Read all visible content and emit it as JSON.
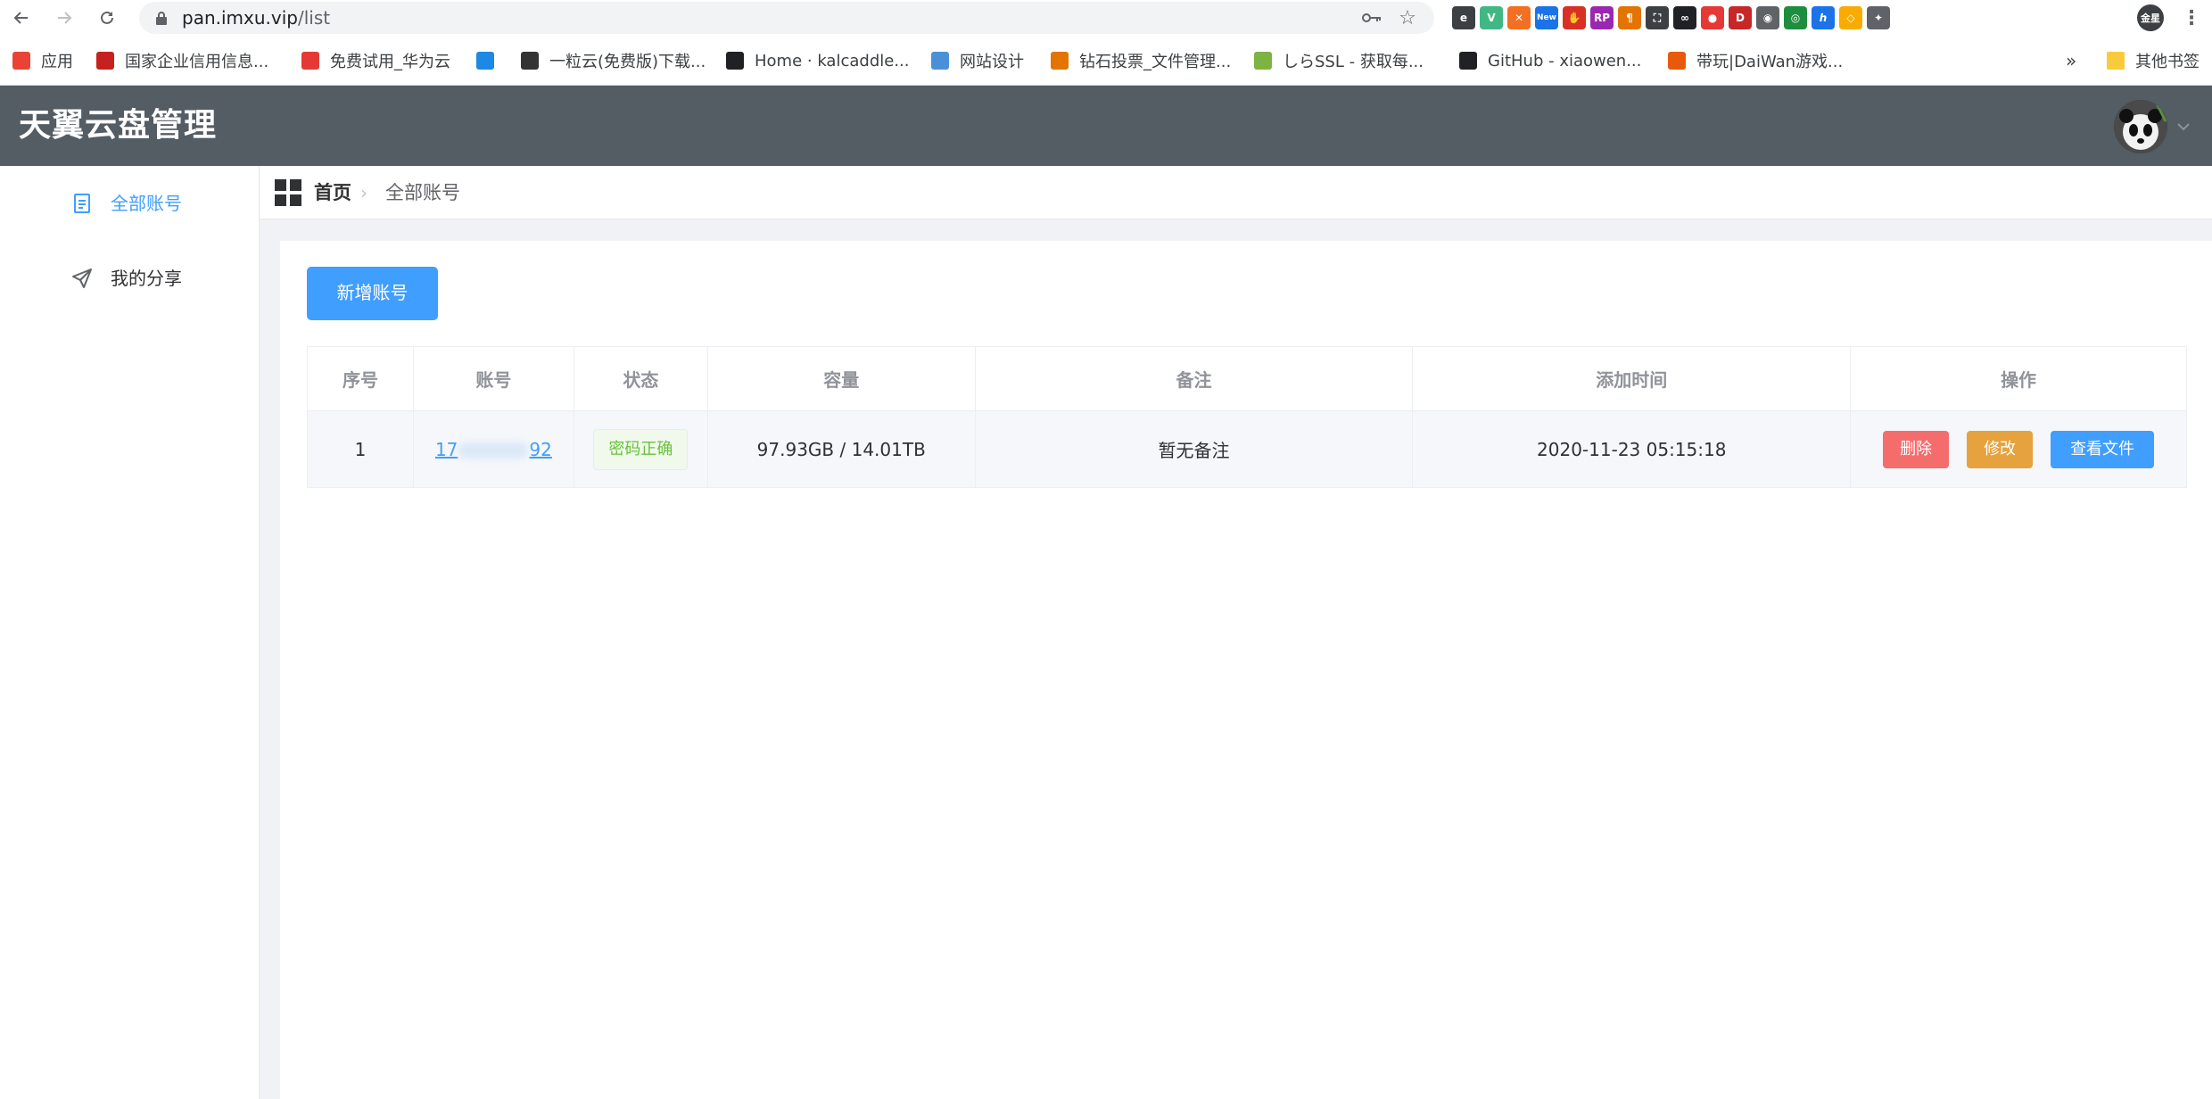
{
  "browser": {
    "url_host": "pan.imxu.vip",
    "url_path": "/list",
    "extensions": [
      {
        "icon": "edge-e-icon",
        "color": "#3c4043",
        "text": "e"
      },
      {
        "icon": "vue-icon",
        "color": "#41b883",
        "text": "V"
      },
      {
        "icon": "orange-circle-icon",
        "color": "#f36f21",
        "text": "✕"
      },
      {
        "icon": "new-badge-icon",
        "color": "#1a73e8",
        "text": "New"
      },
      {
        "icon": "red-hand-icon",
        "color": "#d93025",
        "text": "✋"
      },
      {
        "icon": "axure-rp-icon",
        "color": "#9b27b0",
        "text": "RP"
      },
      {
        "icon": "paragraph-icon",
        "color": "#e37400",
        "text": "¶"
      },
      {
        "icon": "screenshot-frame-icon",
        "color": "#3c4043",
        "text": "⛶"
      },
      {
        "icon": "glasses-icon",
        "color": "#202124",
        "text": "∞"
      },
      {
        "icon": "red-dot-icon",
        "color": "#e53935",
        "text": "●"
      },
      {
        "icon": "dt-icon",
        "color": "#c62828",
        "text": "D"
      },
      {
        "icon": "camera-icon",
        "color": "#5f6368",
        "text": "◉"
      },
      {
        "icon": "green-chat-icon",
        "color": "#1e8e3e",
        "text": "◎"
      },
      {
        "icon": "hh-icon",
        "color": "#1a73e8",
        "text": "ℎ"
      },
      {
        "icon": "orange-box-icon",
        "color": "#f9ab00",
        "text": "◇"
      },
      {
        "icon": "puzzle-icon",
        "color": "#5f6368",
        "text": "✦"
      }
    ],
    "profile_label": "金星"
  },
  "bookmarks": [
    {
      "label": "应用",
      "icon": "apps-grid-icon",
      "color": "#ea4335"
    },
    {
      "label": "国家企业信用信息...",
      "icon": "emblem-icon",
      "color": "#c5221f"
    },
    {
      "label": "免费试用_华为云",
      "icon": "huawei-icon",
      "color": "#e53935"
    },
    {
      "label": "",
      "icon": "m-icon",
      "color": "#1e88e5"
    },
    {
      "label": "一粒云(免费版)下载...",
      "icon": "yiliyun-icon",
      "color": "#333333"
    },
    {
      "label": "Home · kalcaddle...",
      "icon": "github-icon",
      "color": "#202124"
    },
    {
      "label": "网站设计",
      "icon": "cloud-icon",
      "color": "#4a90d9"
    },
    {
      "label": "钻石投票_文件管理...",
      "icon": "chart-icon",
      "color": "#e37400"
    },
    {
      "label": "しらSSL - 获取每...",
      "icon": "ssl-icon",
      "color": "#7cb342"
    },
    {
      "label": "GitHub - xiaowen...",
      "icon": "github-icon",
      "color": "#202124"
    },
    {
      "label": "带玩|DaiWan游戏...",
      "icon": "daiwan-icon",
      "color": "#e8590c"
    }
  ],
  "bookmarks_more": "»",
  "bookmarks_other": "其他书签",
  "app": {
    "title": "天翼云盘管理"
  },
  "sidebar": {
    "items": [
      {
        "label": "全部账号",
        "icon": "document-icon",
        "active": true
      },
      {
        "label": "我的分享",
        "icon": "send-icon",
        "active": false
      }
    ]
  },
  "breadcrumb": {
    "home": "首页",
    "separator": "›",
    "current": "全部账号"
  },
  "toolbar": {
    "add_label": "新增账号"
  },
  "table": {
    "headers": [
      "序号",
      "账号",
      "状态",
      "容量",
      "备注",
      "添加时间",
      "操作"
    ],
    "rows": [
      {
        "index": "1",
        "account_prefix": "17",
        "account_suffix": "92",
        "status": "密码正确",
        "capacity": "97.93GB / 14.01TB",
        "note": "暂无备注",
        "added": "2020-11-23 05:15:18",
        "actions": {
          "delete": "删除",
          "edit": "修改",
          "view": "查看文件"
        }
      }
    ]
  },
  "colors": {
    "header_bg": "#545c64",
    "primary": "#409eff",
    "danger": "#f56c6c",
    "warning": "#e6a23c",
    "success": "#67c23a"
  }
}
